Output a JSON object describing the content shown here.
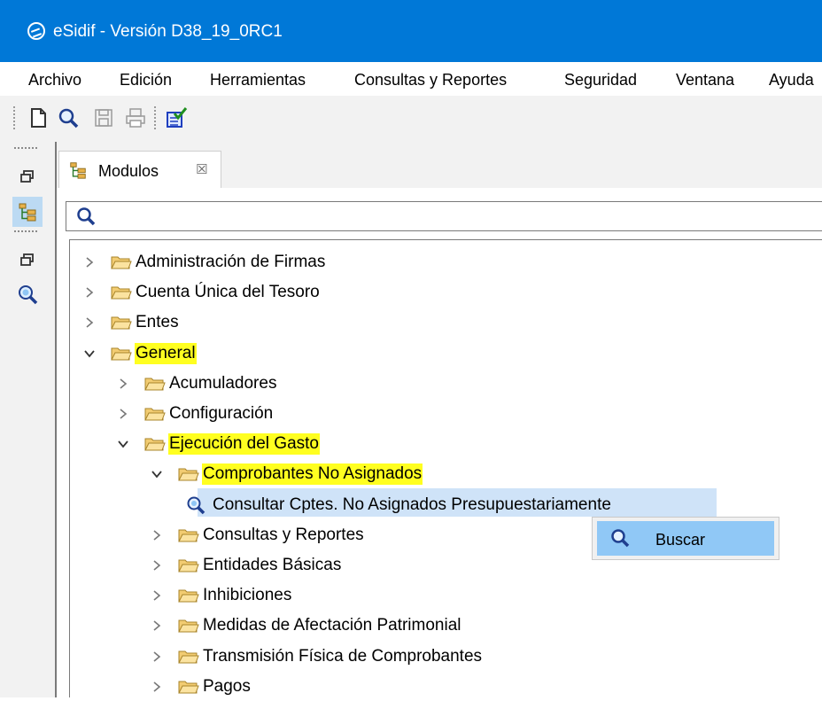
{
  "window": {
    "title": "eSidif - Versión D38_19_0RC1"
  },
  "menubar": {
    "items": [
      "Archivo",
      "Edición",
      "Herramientas",
      "Consultas y Reportes",
      "Seguridad",
      "Ventana",
      "Ayuda"
    ]
  },
  "toolbar": {
    "icons": [
      "new-document-icon",
      "search-icon",
      "save-icon",
      "print-icon",
      "checklist-icon"
    ]
  },
  "side_toolbar": {
    "icons": [
      "restore-icon",
      "tree-view-icon",
      "restore-icon",
      "search-icon"
    ]
  },
  "view": {
    "tab_label": "Modulos",
    "tab_close_glyph": "☒",
    "filter": {
      "value": "",
      "placeholder": ""
    }
  },
  "tree": {
    "items": [
      {
        "label": "Administración de Firmas",
        "depth": 0,
        "expanded": false,
        "highlighted": false
      },
      {
        "label": "Cuenta Única del Tesoro",
        "depth": 0,
        "expanded": false,
        "highlighted": false
      },
      {
        "label": "Entes",
        "depth": 0,
        "expanded": false,
        "highlighted": false
      },
      {
        "label": "General",
        "depth": 0,
        "expanded": true,
        "highlighted": true
      },
      {
        "label": "Acumuladores",
        "depth": 1,
        "expanded": false,
        "highlighted": false
      },
      {
        "label": "Configuración",
        "depth": 1,
        "expanded": false,
        "highlighted": false
      },
      {
        "label": "Ejecución del Gasto",
        "depth": 1,
        "expanded": true,
        "highlighted": true
      },
      {
        "label": "Comprobantes No Asignados",
        "depth": 2,
        "expanded": true,
        "highlighted": true
      },
      {
        "label": "Consultar Cptes. No Asignados Presupuestariamente",
        "depth": 3,
        "leaf": true,
        "selected": true
      },
      {
        "label": "Consultas y Reportes",
        "depth": 2,
        "expanded": false,
        "highlighted": false
      },
      {
        "label": "Entidades Básicas",
        "depth": 2,
        "expanded": false,
        "highlighted": false
      },
      {
        "label": "Inhibiciones",
        "depth": 2,
        "expanded": false,
        "highlighted": false
      },
      {
        "label": "Medidas de Afectación Patrimonial",
        "depth": 2,
        "expanded": false,
        "highlighted": false
      },
      {
        "label": "Transmisión Física de Comprobantes",
        "depth": 2,
        "expanded": false,
        "highlighted": false
      },
      {
        "label": "Pagos",
        "depth": 2,
        "expanded": false,
        "highlighted": false
      }
    ]
  },
  "context_menu": {
    "items": [
      {
        "label": "Buscar",
        "icon": "search-icon"
      }
    ]
  },
  "colors": {
    "titlebar": "#0078d7",
    "highlight": "#ffff20",
    "selection": "#cfe3f8",
    "menu_hover": "#90c8f6",
    "folder": "#f2cc72"
  }
}
